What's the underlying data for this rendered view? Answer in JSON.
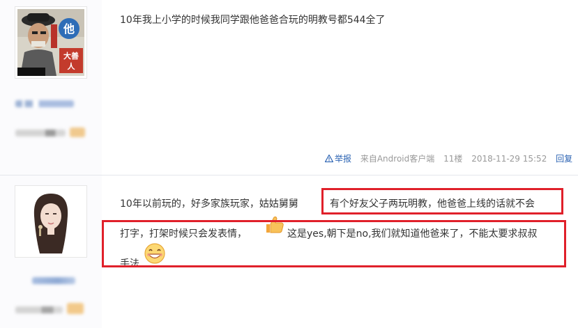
{
  "posts": [
    {
      "avatar_text": [
        "他",
        "大善人"
      ],
      "text": "10年我上小学的时候我同学跟他爸爸合玩的明教号都544全了",
      "meta": {
        "report_label": "举报",
        "source": "来自Android客户端",
        "floor": "11楼",
        "timestamp": "2018-11-29 15:52",
        "reply_label": "回复"
      }
    },
    {
      "line1_prefix": "10年以前玩的，好多家族玩家，姑姑舅舅",
      "line1_boxed": "有个好友父子两玩明教，他爸爸上线的话就不会",
      "line2_a": "打字，打架时候只会发表情，",
      "line2_b": "这是yes,朝下是no,我们就知道他爸来了，不能太要求叔叔",
      "line3": "手法"
    }
  ],
  "colors": {
    "link": "#2d64b3",
    "highlight_box": "#e0202a",
    "meta_text": "#999999"
  },
  "icons": [
    "warning-icon",
    "thumbs-up-emoji",
    "grin-emoji"
  ]
}
